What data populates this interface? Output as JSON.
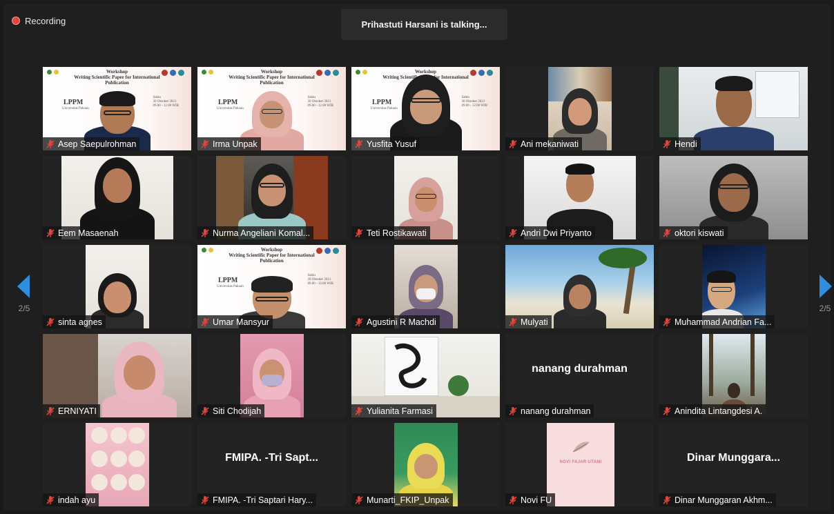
{
  "recording": {
    "label": "Recording"
  },
  "speaker": {
    "text": "Prihastuti Harsani is talking..."
  },
  "pagination": {
    "left_page": "2/5",
    "right_page": "2/5"
  },
  "banner": {
    "title": "Workshop",
    "subtitle": "Writing Scientific Paper for International Publication",
    "org": "LPPM",
    "university": "Universitas Pakuan",
    "day": "Sabtu",
    "date": "30 Oktober 2021",
    "time": "09.00 - 12.00 WIB"
  },
  "participants": [
    {
      "name": "Asep Saepulrohman",
      "muted": true
    },
    {
      "name": "Irma Unpak",
      "muted": true
    },
    {
      "name": "Yusfita Yusuf",
      "muted": true
    },
    {
      "name": "Ani mekaniwati",
      "muted": true
    },
    {
      "name": "Hendi",
      "muted": true
    },
    {
      "name": "Eem Masaenah",
      "muted": true
    },
    {
      "name": "Nurma Angeliani Komal...",
      "muted": true
    },
    {
      "name": "Teti Rostikawati",
      "muted": true
    },
    {
      "name": "Andri Dwi Priyanto",
      "muted": true
    },
    {
      "name": "oktori kiswati",
      "muted": true
    },
    {
      "name": "sinta agnes",
      "muted": true
    },
    {
      "name": "Umar Mansyur",
      "muted": true
    },
    {
      "name": "Agustini R Machdi",
      "muted": true
    },
    {
      "name": "Mulyati",
      "muted": true
    },
    {
      "name": "Muhammad Andrian Fa...",
      "muted": true
    },
    {
      "name": "ERNIYATI",
      "muted": true
    },
    {
      "name": "Siti Chodijah",
      "muted": true
    },
    {
      "name": "Yulianita Farmasi",
      "muted": true
    },
    {
      "name": "nanang durahman",
      "muted": true,
      "display": "nanang durahman"
    },
    {
      "name": "Anindita Lintangdesi A.",
      "muted": true
    },
    {
      "name": "indah ayu",
      "muted": true
    },
    {
      "name": "FMIPA. -Tri Saptari Hary...",
      "muted": true,
      "display": "FMIPA. -Tri Sapt..."
    },
    {
      "name": "Munarti_FKIP_Unpak",
      "muted": true
    },
    {
      "name": "Novi FU",
      "muted": true,
      "card": "NOVI FAJAR UTAMI"
    },
    {
      "name": "Dinar Munggaran Akhm...",
      "muted": true,
      "display": "Dinar  Munggara..."
    }
  ],
  "colors": {
    "muted_icon": "#e0463c",
    "nav_arrow": "#2f8fde",
    "background": "#1f1f1f"
  }
}
